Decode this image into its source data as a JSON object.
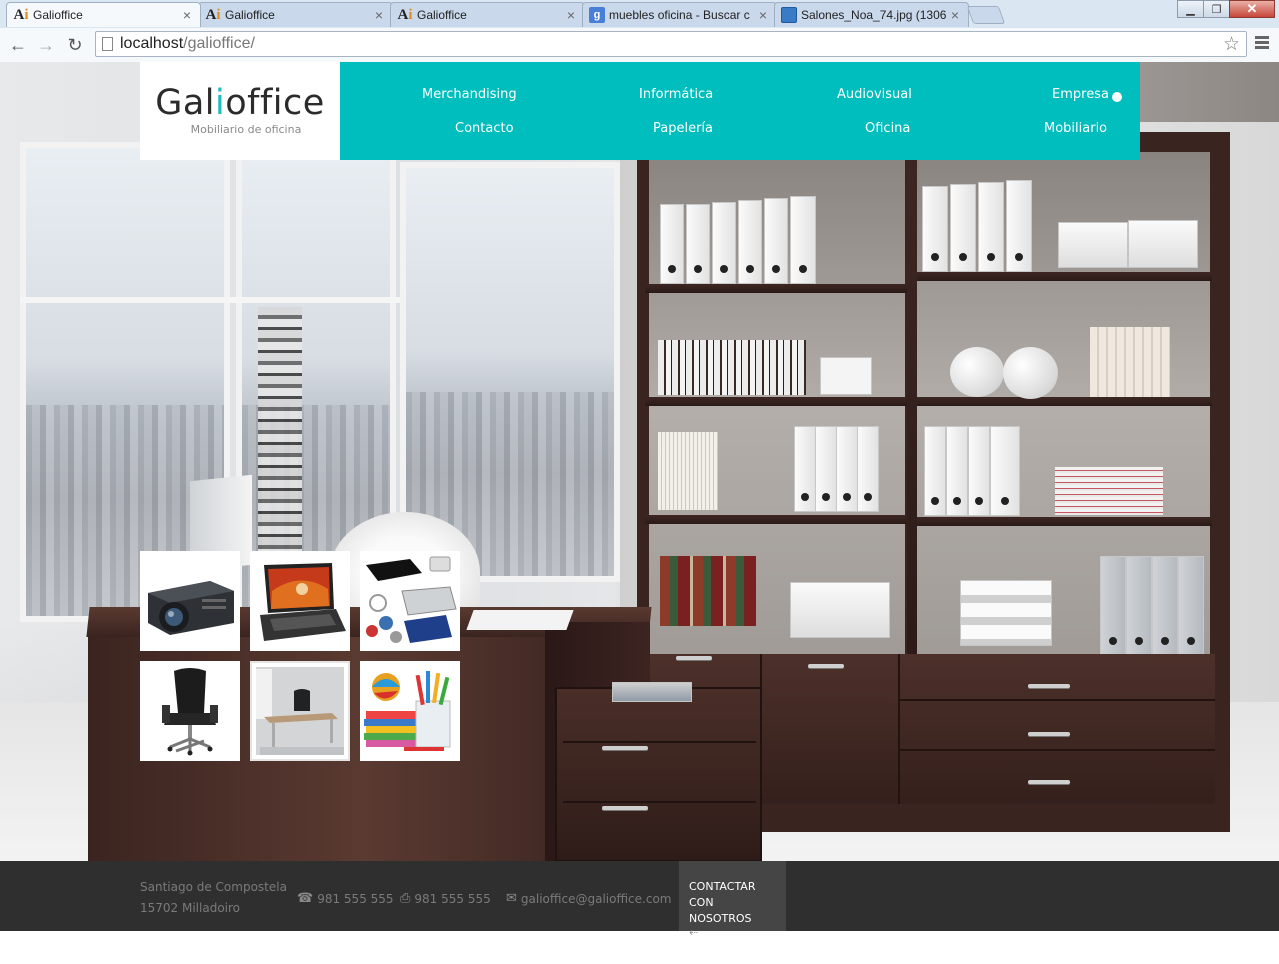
{
  "browser": {
    "tabs": [
      {
        "title": "Galioffice",
        "favicon": "ai-icon",
        "active": true
      },
      {
        "title": "Galioffice",
        "favicon": "ai-icon",
        "active": false
      },
      {
        "title": "Galioffice",
        "favicon": "ai-icon",
        "active": false
      },
      {
        "title": "muebles oficina - Buscar c",
        "favicon": "google-icon",
        "active": false
      },
      {
        "title": "Salones_Noa_74.jpg (1306",
        "favicon": "image-icon",
        "active": false
      }
    ],
    "url_host": "localhost",
    "url_path": "/galioffice/"
  },
  "header": {
    "logo": {
      "part1": "Gal",
      "accent": "i",
      "part2": "office",
      "subtitle": "Mobiliario de oficina"
    },
    "nav": {
      "merchandising": "Merchandising",
      "informatica": "Informática",
      "audiovisual": "Audiovisual",
      "empresa": "Empresa",
      "contacto": "Contacto",
      "papeleria": "Papelería",
      "oficina": "Oficina",
      "mobiliario": "Mobiliario"
    },
    "accent_color": "#00bebd"
  },
  "thumbnails": [
    {
      "name": "projector"
    },
    {
      "name": "laptop"
    },
    {
      "name": "card-holders-keychains"
    },
    {
      "name": "office-chair"
    },
    {
      "name": "office-desk"
    },
    {
      "name": "stationery"
    }
  ],
  "footer": {
    "address_line1": "Santiago de Compostela",
    "address_line2": "15702 Milladoiro",
    "phone": "981 555 555",
    "fax": "981 555 555",
    "email": "galioffice@galioffice.com",
    "cta_line1": "CONTACTAR",
    "cta_line2": "CON NOSOTROS",
    "cta_arrow": "⇠"
  }
}
